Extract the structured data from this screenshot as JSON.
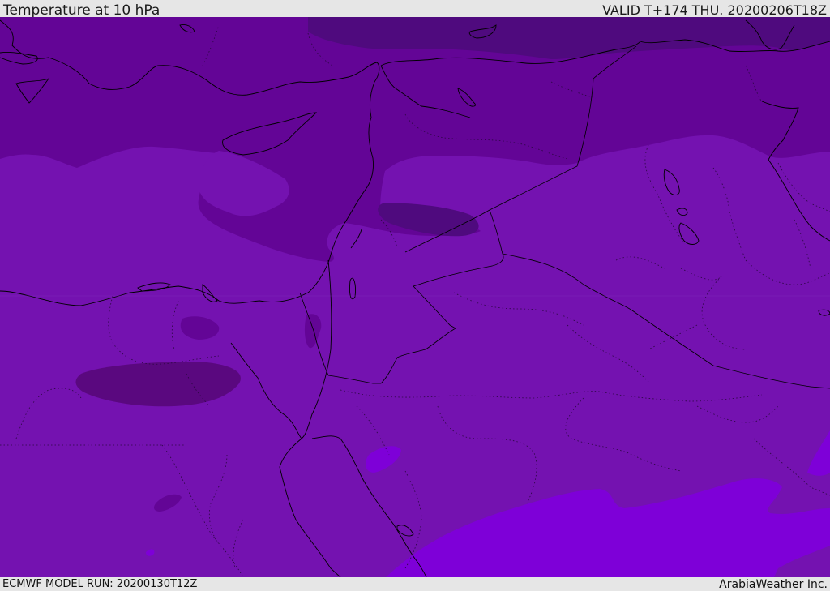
{
  "header": {
    "title": "Temperature at 10 hPa",
    "valid": "VALID T+174 THU. 20200206T18Z"
  },
  "footer": {
    "model_run": "ECMWF MODEL RUN: 20200130T12Z",
    "brand": "ArabiaWeather Inc."
  },
  "map": {
    "fields": [
      "temperature-10hpa"
    ],
    "colors": {
      "coldest": "#4f0a7e",
      "very_cold": "#630596",
      "cold": "#7412b0",
      "mild": "#7e00d8",
      "coastline": "#000000",
      "border": "#000000"
    }
  }
}
